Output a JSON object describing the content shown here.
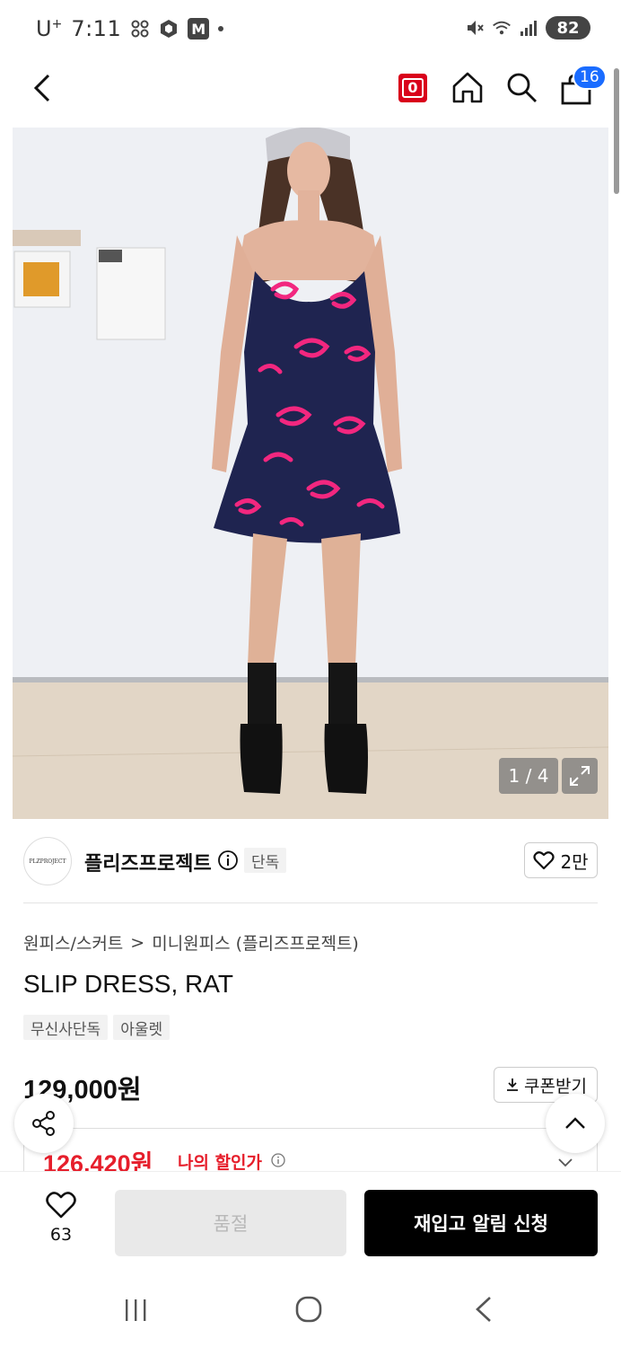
{
  "status_bar": {
    "carrier": "U",
    "carrier_sup": "+",
    "time": "7:11",
    "m_badge": "M",
    "battery": "82"
  },
  "header": {
    "zero_badge": "0",
    "cart_count": "16"
  },
  "gallery": {
    "counter": "1 / 4"
  },
  "brand": {
    "logo_text": "PLZPROJECT",
    "name": "플리즈프로젝트",
    "exclusive_tag": "단독",
    "likes": "2만"
  },
  "breadcrumb": {
    "category": "원피스/스커트",
    "separator": ">",
    "subcategory": "미니원피스 (플리즈프로젝트)"
  },
  "product": {
    "title": "SLIP DRESS, RAT",
    "tags": [
      "무신사단독",
      "아울렛"
    ],
    "price": "129,000원",
    "coupon_label": "쿠폰받기",
    "discount_price": "126,420원",
    "discount_label": "나의 할인가"
  },
  "action_bar": {
    "wish_count": "63",
    "soldout_label": "품절",
    "restock_label": "재입고 알림 신청"
  },
  "colors": {
    "accent_red": "#e61e2b",
    "badge_blue": "#1a6cff",
    "primary_black": "#000000"
  }
}
